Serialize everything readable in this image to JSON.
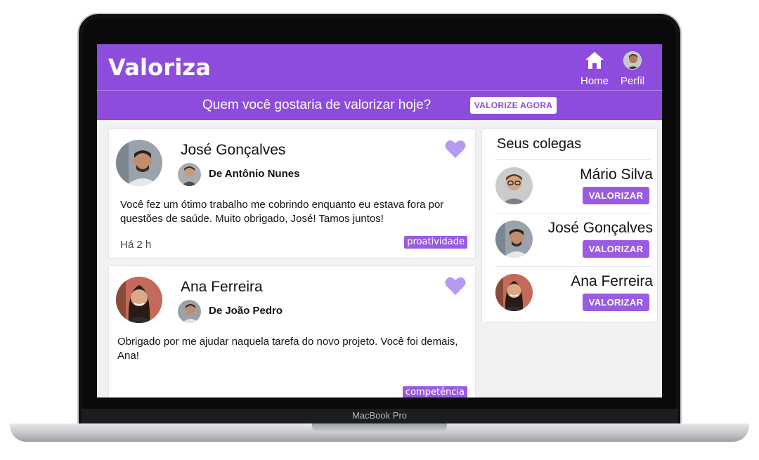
{
  "device": {
    "label": "MacBook Pro"
  },
  "header": {
    "brand": "Valoriza",
    "nav": [
      {
        "label": "Home",
        "icon": "home-icon"
      },
      {
        "label": "Perfil",
        "icon": "avatar"
      }
    ]
  },
  "banner": {
    "question": "Quem você gostaria de valorizar hoje?",
    "cta_label": "VALORIZE AGORA"
  },
  "posts": [
    {
      "name": "José Gonçalves",
      "from": "De Antônio Nunes",
      "message": "Você fez um ótimo trabalho me cobrindo enquanto eu estava fora por questões de saúde. Muito obrigado, José! Tamos juntos!",
      "time": "Há 2 h",
      "tag": "proatividade",
      "liked": true
    },
    {
      "name": "Ana Ferreira",
      "from": "De João Pedro",
      "message": "Obrigado por me ajudar naquela tarefa do novo projeto. Você foi demais, Ana!",
      "time": "",
      "tag": "competência",
      "liked": true
    }
  ],
  "colleagues": {
    "title": "Seus colegas",
    "items": [
      {
        "name": "Mário Silva",
        "button": "VALORIZAR"
      },
      {
        "name": "José Gonçalves",
        "button": "VALORIZAR"
      },
      {
        "name": "Ana Ferreira",
        "button": "VALORIZAR"
      }
    ]
  },
  "colors": {
    "primary": "#8e4cdc",
    "button": "#9a5be3",
    "heart": "#b49af0",
    "background": "#f1f1f4"
  }
}
